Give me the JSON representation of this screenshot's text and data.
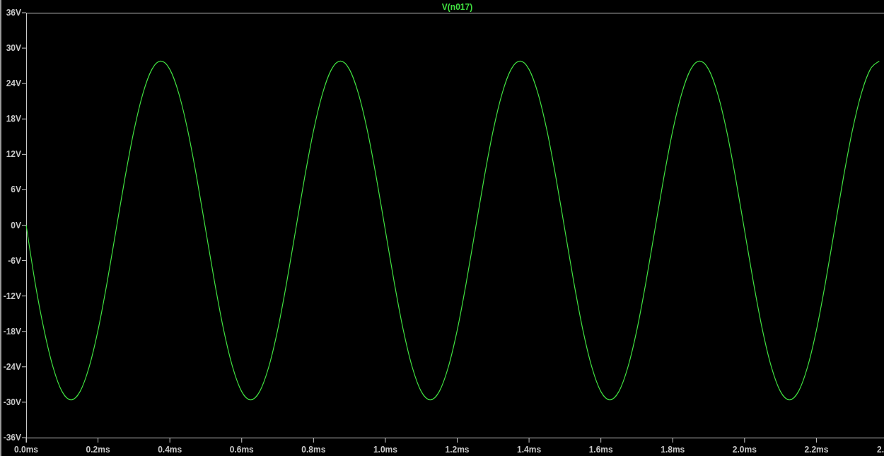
{
  "plot": {
    "chart_data": {
      "type": "line",
      "x": [
        0,
        0.025,
        0.05,
        0.075,
        0.1,
        0.125,
        0.15,
        0.175,
        0.2,
        0.225,
        0.25,
        0.275,
        0.3,
        0.325,
        0.35,
        0.375,
        0.4,
        0.425,
        0.45,
        0.475,
        0.5,
        0.525,
        0.55,
        0.575,
        0.6,
        0.625,
        0.65,
        0.675,
        0.7,
        0.725,
        0.75,
        0.775,
        0.8,
        0.825,
        0.85,
        0.875,
        0.9,
        0.925,
        0.95,
        0.975,
        1,
        1.025,
        1.05,
        1.075,
        1.1,
        1.125,
        1.15,
        1.175,
        1.2,
        1.225,
        1.25,
        1.275,
        1.3,
        1.325,
        1.35,
        1.375,
        1.4,
        1.425,
        1.45,
        1.475,
        1.5,
        1.525,
        1.55,
        1.575,
        1.6,
        1.625,
        1.65,
        1.675,
        1.7,
        1.725,
        1.75,
        1.775,
        1.8,
        1.825,
        1.85,
        1.875,
        1.9,
        1.925,
        1.95,
        1.975,
        2,
        2.025,
        2.05,
        2.075,
        2.1,
        2.125,
        2.15,
        2.175,
        2.2,
        2.225,
        2.25,
        2.275,
        2.3,
        2.325,
        2.35,
        2.375
      ],
      "series": [
        {
          "name": "V(n017)",
          "color": "#40e040",
          "values": [
            0,
            -9.8,
            -17.8,
            -24.1,
            -28.2,
            -29.6,
            -28.2,
            -24.1,
            -17.8,
            -9.8,
            -0.9,
            8.0,
            16.0,
            22.3,
            26.4,
            27.8,
            26.4,
            22.3,
            16.0,
            8.0,
            -0.9,
            -9.8,
            -17.8,
            -24.1,
            -28.2,
            -29.6,
            -28.2,
            -24.1,
            -17.8,
            -9.8,
            -0.9,
            8.0,
            16.0,
            22.3,
            26.4,
            27.8,
            26.4,
            22.3,
            16.0,
            8.0,
            -0.9,
            -9.8,
            -17.8,
            -24.1,
            -28.2,
            -29.6,
            -28.2,
            -24.1,
            -17.8,
            -9.8,
            -0.9,
            8.0,
            16.0,
            22.3,
            26.4,
            27.8,
            26.4,
            22.3,
            16.0,
            8.0,
            -0.9,
            -9.8,
            -17.8,
            -24.1,
            -28.2,
            -29.6,
            -28.2,
            -24.1,
            -17.8,
            -9.8,
            -0.9,
            8.0,
            16.0,
            22.3,
            26.4,
            27.8,
            26.4,
            22.3,
            16.0,
            8.0,
            -0.9,
            -9.8,
            -17.8,
            -24.1,
            -28.2,
            -29.6,
            -28.2,
            -24.1,
            -17.8,
            -9.8,
            -0.9,
            8.0,
            16.0,
            22.3,
            26.4,
            27.8
          ]
        }
      ],
      "xlim": [
        0,
        2.4
      ],
      "ylim": [
        -36,
        36
      ],
      "xticks": [
        {
          "value": 0,
          "label": "0.0ms"
        },
        {
          "value": 0.2,
          "label": "0.2ms"
        },
        {
          "value": 0.4,
          "label": "0.4ms"
        },
        {
          "value": 0.6,
          "label": "0.6ms"
        },
        {
          "value": 0.8,
          "label": "0.8ms"
        },
        {
          "value": 1.0,
          "label": "1.0ms"
        },
        {
          "value": 1.2,
          "label": "1.2ms"
        },
        {
          "value": 1.4,
          "label": "1.4ms"
        },
        {
          "value": 1.6,
          "label": "1.6ms"
        },
        {
          "value": 1.8,
          "label": "1.8ms"
        },
        {
          "value": 2.0,
          "label": "2.0ms"
        },
        {
          "value": 2.2,
          "label": "2.2ms"
        },
        {
          "value": 2.4,
          "label": "2."
        }
      ],
      "yticks": [
        {
          "value": 36,
          "label": "36V"
        },
        {
          "value": 30,
          "label": "30V"
        },
        {
          "value": 24,
          "label": "24V"
        },
        {
          "value": 18,
          "label": "18V"
        },
        {
          "value": 12,
          "label": "12V"
        },
        {
          "value": 6,
          "label": "6V"
        },
        {
          "value": 0,
          "label": "0V"
        },
        {
          "value": -6,
          "label": "-6V"
        },
        {
          "value": -12,
          "label": "-12V"
        },
        {
          "value": -18,
          "label": "-18V"
        },
        {
          "value": -24,
          "label": "-24V"
        },
        {
          "value": -30,
          "label": "-30V"
        },
        {
          "value": -36,
          "label": "-36V"
        }
      ]
    }
  }
}
